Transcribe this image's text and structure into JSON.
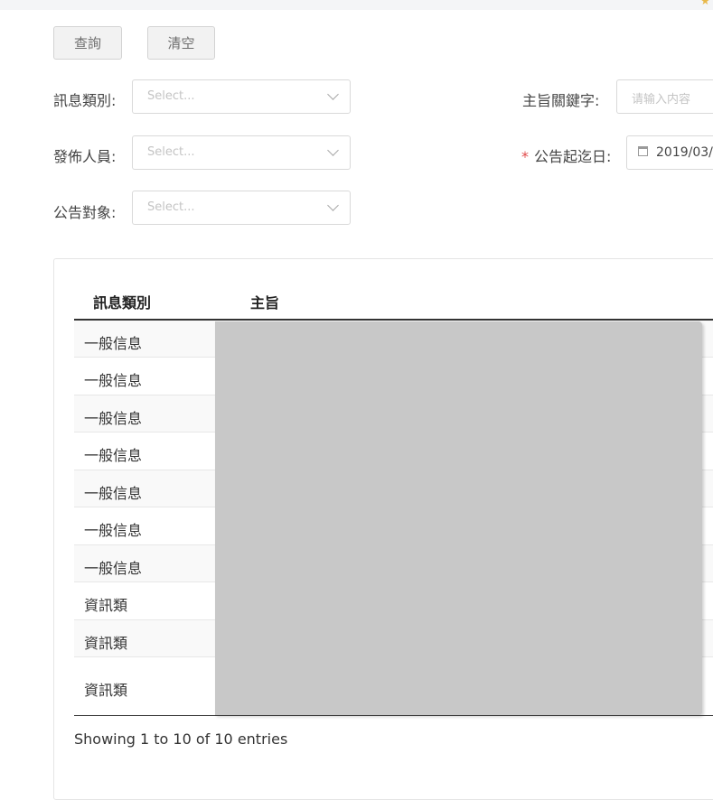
{
  "toolbar": {
    "query_label": "查詢",
    "clear_label": "清空"
  },
  "filters": {
    "msg_type": {
      "label": "訊息類別:",
      "placeholder": "Select..."
    },
    "publisher": {
      "label": "發佈人員:",
      "placeholder": "Select..."
    },
    "audience": {
      "label": "公告對象:",
      "placeholder": "Select..."
    },
    "keyword": {
      "label": "主旨關鍵字:",
      "placeholder": "请输入内容"
    },
    "date_range": {
      "required_mark": "*",
      "label": "公告起迄日:",
      "value": "2019/03/"
    }
  },
  "table": {
    "columns": [
      "訊息類別",
      "主旨"
    ],
    "rows": [
      {
        "type": "一般信息"
      },
      {
        "type": "一般信息"
      },
      {
        "type": "一般信息"
      },
      {
        "type": "一般信息"
      },
      {
        "type": "一般信息"
      },
      {
        "type": "一般信息"
      },
      {
        "type": "一般信息"
      },
      {
        "type": "資訊類"
      },
      {
        "type": "資訊類"
      },
      {
        "type": "資訊類"
      }
    ],
    "info": "Showing 1 to 10 of 10 entries"
  },
  "colors": {
    "redaction": "#c8c8c8",
    "required": "#e14b4b"
  }
}
